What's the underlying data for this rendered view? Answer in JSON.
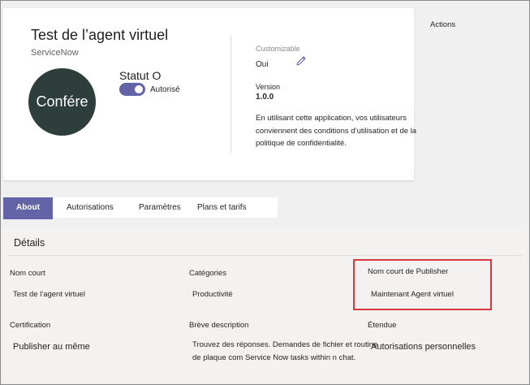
{
  "app": {
    "title": "Test de l’agent virtuel",
    "publisher": "ServiceNow",
    "avatar_text": "Confére",
    "status_label": "Statut O",
    "status_toggle_label": "Autorisé",
    "status_on": true,
    "customizable_label": "Customizable",
    "customizable_value": "Oui",
    "version_label": "Version",
    "version_value": "1.0.0",
    "terms_text": "En utilisant cette application, vos utilisateurs conviennent des conditions d’utilisation et de la politique de confidentialité."
  },
  "actions_label": "Actions",
  "tabs": [
    {
      "label": "About",
      "active": true
    },
    {
      "label": "Autorisations",
      "active": false
    },
    {
      "label": "Paramètres",
      "active": false
    },
    {
      "label": "Plans et tarifs",
      "active": false
    }
  ],
  "details": {
    "title": "Détails",
    "short_name_label": "Nom court",
    "short_name_value": "Test de l'agent virtuel",
    "categories_label": "Catégories",
    "categories_value": "Productivité",
    "publisher_short_label": "Nom court de Publisher",
    "publisher_short_value": "Maintenant Agent virtuel",
    "certification_label": "Certification",
    "certification_value": "Publisher au même",
    "description_label": "Brève description",
    "description_value": "Trouvez des réponses. Demandes de fichier et routine de plaque com Service Now tasks within n chat.",
    "scope_label": "Étendue",
    "scope_value": "Autorisations personnelles"
  },
  "colors": {
    "accent": "#6264a7",
    "avatar_bg": "#2d3e3b",
    "highlight_border": "#d9373d"
  },
  "icons": {
    "edit": "pencil-icon"
  }
}
